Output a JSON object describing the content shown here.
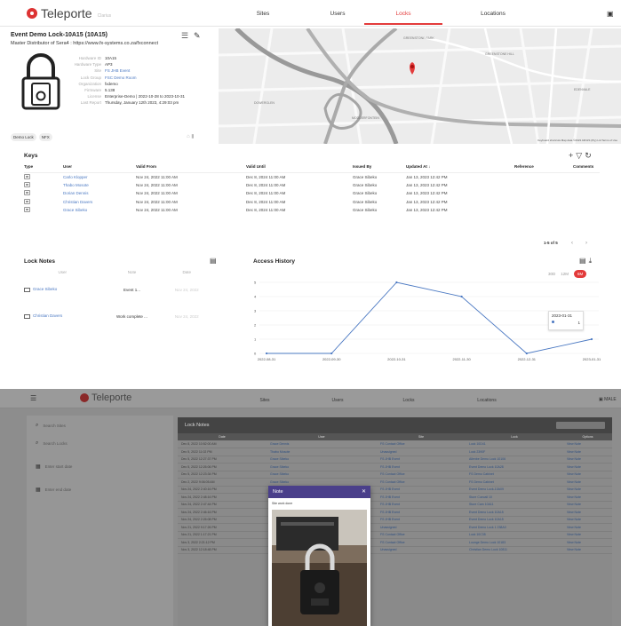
{
  "app": {
    "name": "Teleporte",
    "tagline": "Clarius"
  },
  "nav": {
    "tabs": [
      "Sites",
      "Users",
      "Locks",
      "Locations"
    ],
    "active": "Locks"
  },
  "lock": {
    "title": "Event Demo Lock-10A15 (10A15)",
    "distributor": "Master Distributor of Sera4 : https://www.fx-systems.co.za/fxconnect",
    "details": [
      {
        "k": "Hardware ID",
        "v": "10A15",
        "link": false
      },
      {
        "k": "Hardware Type",
        "v": "AP3",
        "link": false
      },
      {
        "k": "Site",
        "v": "FS JHB Event",
        "link": true
      },
      {
        "k": "Lock Group",
        "v": "FSC Demo Room",
        "link": true
      },
      {
        "k": "Organization",
        "v": "fxdemo",
        "link": false
      },
      {
        "k": "Firmware",
        "v": "5.138",
        "link": false
      },
      {
        "k": "License",
        "v": "Enterprise-Demo | 2022-10-28 to 2023-10-31",
        "link": false
      },
      {
        "k": "Last Report",
        "v": "Thursday, January 12th 2023, 4:29:03 pm",
        "link": false
      }
    ],
    "chips": [
      "Demo Lock",
      "NFX"
    ]
  },
  "map": {
    "labels": [
      "GREENSTONE PARK",
      "GREENSTONE HILL",
      "EDENVALE",
      "MODDERFONTEIN",
      "DOWERGLEN"
    ],
    "footer": "Keyboard shortcuts   Map data ©2023 AfriGIS (Pty) Ltd   Terms of Use"
  },
  "keys": {
    "title": "Keys",
    "columns": [
      "Type",
      "User",
      "Valid From",
      "Valid Until",
      "Issued By",
      "Updated At ↓",
      "Reference",
      "Comments"
    ],
    "rows": [
      [
        "",
        "Carlo Klopper",
        "Nov 24, 2022 11:00 AM",
        "Dec 8, 2024 11:00 AM",
        "Grace Sibeko",
        "Jan 13, 2023 12:42 PM",
        "",
        ""
      ],
      [
        "",
        "Thabo Mosote",
        "Nov 24, 2022 11:00 AM",
        "Dec 8, 2024 11:00 AM",
        "Grace Sibeko",
        "Jan 13, 2023 12:42 PM",
        "",
        ""
      ],
      [
        "",
        "Dorian Dennis",
        "Nov 24, 2022 11:00 AM",
        "Dec 8, 2024 11:00 AM",
        "Grace Sibeko",
        "Jan 13, 2023 12:42 PM",
        "",
        ""
      ],
      [
        "",
        "Christian Davers",
        "Nov 24, 2022 11:00 AM",
        "Dec 8, 2024 11:00 AM",
        "Grace Sibeko",
        "Jan 13, 2023 12:42 PM",
        "",
        ""
      ],
      [
        "",
        "Grace Sibeko",
        "Nov 24, 2022 11:00 AM",
        "Dec 8, 2024 11:00 AM",
        "Grace Sibeko",
        "Jan 13, 2023 12:42 PM",
        "",
        ""
      ]
    ],
    "pager": "1-5 of 5"
  },
  "notes": {
    "title": "Lock Notes",
    "columns": [
      "User",
      "Note",
      "Date"
    ],
    "rows": [
      {
        "user": "Grace Sibeko",
        "note": "Event 1...",
        "date": "Nov 24, 2022"
      },
      {
        "user": "Christian Davers",
        "note": "Work complete ...",
        "date": "Nov 24, 2022"
      }
    ]
  },
  "access": {
    "title": "Access History",
    "ranges": [
      "30D",
      "12M",
      "6M"
    ],
    "active_range": "6M",
    "tooltip": {
      "date": "2023-01-31",
      "value": "1"
    }
  },
  "chart_data": {
    "type": "line",
    "title": "Access History",
    "x": [
      "2022-08-31",
      "2022-09-30",
      "2022-10-31",
      "2022-11-30",
      "2022-12-31",
      "2023-01-31"
    ],
    "series": [
      {
        "values": [
          0,
          0,
          5,
          4,
          0,
          1
        ]
      }
    ],
    "ylim": [
      0,
      5
    ],
    "yticks": [
      0,
      1,
      2,
      3,
      4,
      5
    ],
    "color": "#4a78c2",
    "grid": true
  },
  "bottom": {
    "nav_tabs": [
      "Sites",
      "Users",
      "Locks",
      "Locations"
    ],
    "nav_icon_label": "MALE",
    "filters": [
      "Search Sites",
      "Search Locks",
      "Enter start date",
      "Enter end date"
    ],
    "card_title": "Lock Notes",
    "columns": [
      "Date",
      "User",
      "Site",
      "Lock",
      "Options"
    ],
    "rows": [
      [
        "Dec 8, 2022 10:52:00 AM",
        "Grace Dennis",
        "FS Contact Office",
        "Lock 10D41",
        "View Note"
      ],
      [
        "Dec 5, 2022 11:02 PM",
        "Thabo Mosote",
        "Unassigned",
        "Lock 2390F",
        "View Note"
      ],
      [
        "Dec 5, 2022 12:27:37 PM",
        "Grace Sibeko",
        "FS JHB Event",
        "Allenbe Demo Lock 10106",
        "View Note"
      ],
      [
        "Dec 5, 2022 12:26:06 PM",
        "Grace Sibeko",
        "FS JHB Event",
        "Event Demo Lock 10A28",
        "View Note"
      ],
      [
        "Dec 5, 2022 12:23:34 PM",
        "Grace Sibeko",
        "FS Contact Office",
        "FS Demo Cabinet",
        "View Note"
      ],
      [
        "Dec 2, 2022 9:06:05 AM",
        "Grace Sibeko",
        "FS Contact Office",
        "FS Demo Cabinet",
        "View Note"
      ],
      [
        "Nov 24, 2022 2:40:16 PM",
        "Grace Sibeko",
        "FS JHB Event",
        "Event Demo Lock-10A09",
        "View Note"
      ],
      [
        "Nov 24, 2022 2:48:16 PM",
        "Grace Sibeko",
        "FS JHB Event",
        "Store Cuecall 10",
        "View Note"
      ],
      [
        "Nov 24, 2022 2:47:44 PM",
        "Grace Sibeko",
        "FS JHB Event",
        "Store Cam 10A11",
        "View Note"
      ],
      [
        "Nov 24, 2022 2:46:16 PM",
        "Grace Sibeko",
        "FS JHB Event",
        "Event Demo Lock 10A15",
        "View Note"
      ],
      [
        "Nov 24, 2022 2:26:08 PM",
        "Christian Davers",
        "FS JHB Event",
        "Event Demo Lock 10A15",
        "View Note"
      ],
      [
        "Nov 21, 2022 9:17:26 PM",
        "Grace Sibeko",
        "Unassigned",
        "Event Demo Lock 1 238A0",
        "View Note"
      ],
      [
        "Nov 21, 2022 1:17:21 PM",
        "Grace Sibeko",
        "FS Contact Office",
        "Lock 10C35",
        "View Note"
      ],
      [
        "Nov 3, 2022 2:21:12 PM",
        "Grace Sibeko",
        "FS Contact Office",
        "Lounge Demo Lock 10183",
        "View Note"
      ],
      [
        "Nov 3, 2022 12:18:48 PM",
        "Grace Sibeko",
        "Unassigned",
        "Christian Demo Lock 10811",
        "View Note"
      ]
    ],
    "modal": {
      "title": "Note",
      "text": "Site work done"
    }
  },
  "colors": {
    "accent": "#e33b3b",
    "link": "#4a78c2",
    "modal_header": "#4a3f8a"
  }
}
